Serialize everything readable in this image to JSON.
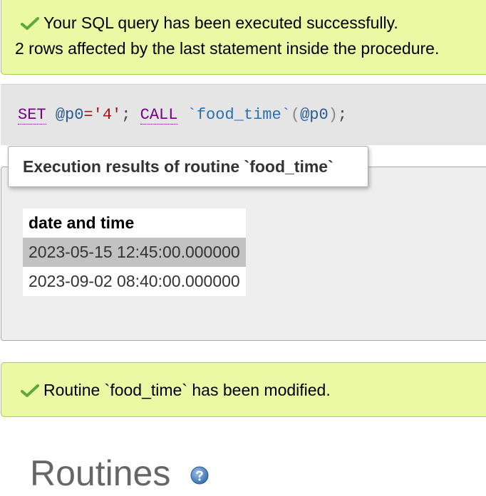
{
  "success_notice": {
    "line1": "Your SQL query has been executed successfully.",
    "line2": "2 rows affected by the last statement inside the procedure.",
    "icon": "check-icon"
  },
  "sql": {
    "kw_set": "SET",
    "var": "@p0",
    "op": "=",
    "value": "'4'",
    "semi1": ";",
    "kw_call": "CALL",
    "routine": "`food_time`",
    "open_paren": "(",
    "arg": "@p0",
    "close_paren": ")",
    "semi2": ";"
  },
  "results": {
    "legend": "Execution results of routine `food_time`",
    "column": "date and time",
    "rows": [
      "2023-05-15 12:45:00.000000",
      "2023-09-02 08:40:00.000000"
    ]
  },
  "modified_notice": {
    "text": "Routine `food_time` has been modified.",
    "icon": "check-icon"
  },
  "routines": {
    "title": "Routines",
    "help_icon": "help-icon"
  },
  "colors": {
    "notice_bg": "#ebf8a4",
    "notice_border": "#a2d246",
    "check": "#5fa83a",
    "sql_bg": "#e5e5e5",
    "highlight_row": "#c2c2c2"
  }
}
